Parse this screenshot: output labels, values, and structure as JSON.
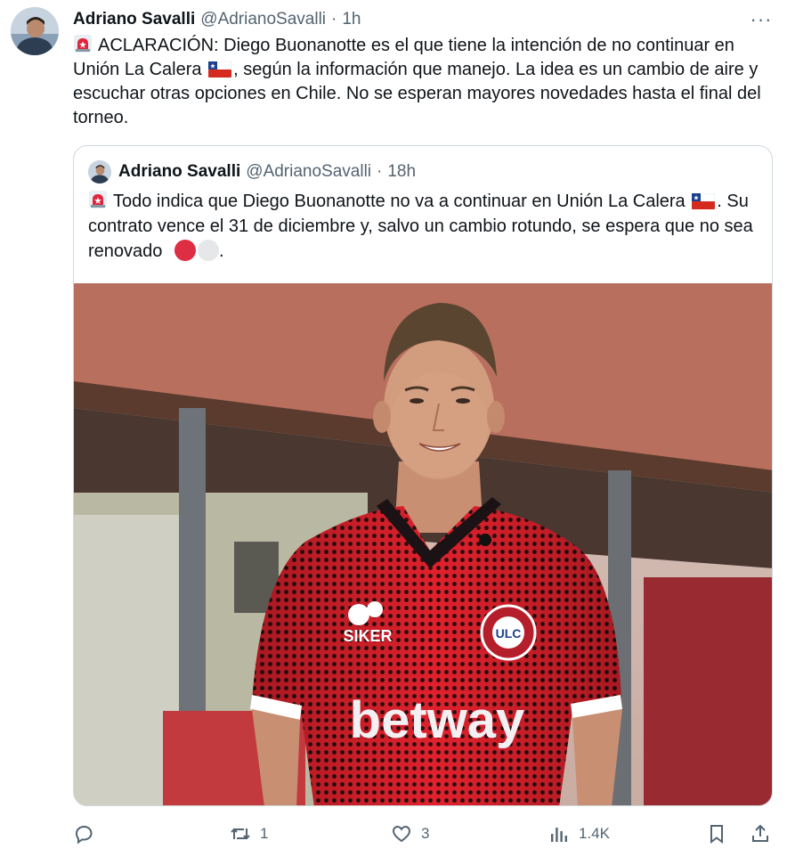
{
  "tweet": {
    "author_name": "Adriano Savalli",
    "author_handle": "@AdrianoSavalli",
    "separator": "·",
    "time": "1h",
    "more_label": "···",
    "text_part1": "ACLARACIÓN: Diego Buonanotte es el que tiene la intención de no continuar en Unión La Calera",
    "text_part2": ", según la información que manejo. La idea es un cambio de aire y escuchar otras opciones en Chile. No se esperan mayores novedades hasta el final del torneo."
  },
  "quoted": {
    "author_name": "Adriano Savalli",
    "author_handle": "@AdrianoSavalli",
    "separator": "·",
    "time": "18h",
    "text_part1": "Todo indica que Diego Buonanotte no va a continuar en Unión La Calera",
    "text_part2": ". Su contrato vence el 31 de diciembre y, salvo un cambio rotundo, se espera que no sea renovado",
    "text_part3": ".",
    "photo": {
      "jersey_brand": "SIKER",
      "jersey_sponsor": "betway",
      "crest_text": "ULC",
      "crest_ring_top": "UNIÓN",
      "crest_ring_bottom": "LA CALERA"
    }
  },
  "actions": {
    "reply_count": "",
    "retweet_count": "1",
    "like_count": "3",
    "views_count": "1.4K"
  },
  "icons": {
    "siren": "police-siren-emoji",
    "flag": "chile-flag-emoji",
    "red_circle": "red-circle-emoji",
    "white_circle": "white-circle-emoji"
  },
  "colors": {
    "text": "#0f1419",
    "secondary": "#536471",
    "border": "#cfd9de",
    "jersey_red": "#d41e27"
  }
}
